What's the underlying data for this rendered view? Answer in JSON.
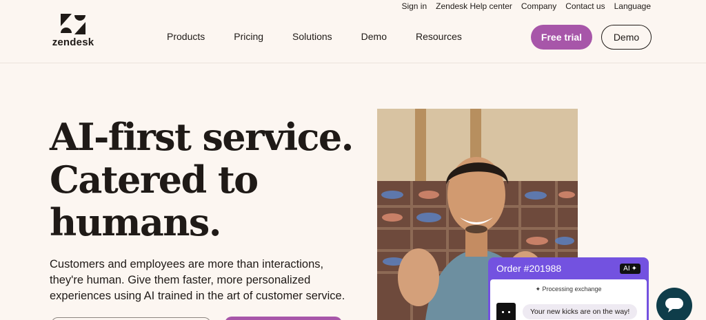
{
  "brand": {
    "name": "zendesk"
  },
  "utility_nav": [
    "Sign in",
    "Zendesk Help center",
    "Company",
    "Contact us",
    "Language"
  ],
  "main_nav": [
    "Products",
    "Pricing",
    "Solutions",
    "Demo",
    "Resources"
  ],
  "buttons": {
    "free_trial": "Free trial",
    "demo": "Demo"
  },
  "hero": {
    "title_lines": [
      "AI-first service.",
      "Catered to",
      "humans."
    ],
    "subtitle": "Customers and employees are more than interactions, they're human. Give them faster, more personalized experiences using AI trained in the art of customer service."
  },
  "chat_card": {
    "order": "Order #201988",
    "ai_badge": "AI",
    "processing": "Processing exchange",
    "message": "Your new kicks are on the way!"
  },
  "colors": {
    "accent": "#a756a9",
    "chat_purple": "#7352e0",
    "launcher": "#0f3d4a",
    "background": "#fcf6f1"
  },
  "icons": {
    "logo": "zendesk-logo",
    "sparkle": "sparkle-icon",
    "launcher": "chat-bubble-icon"
  }
}
